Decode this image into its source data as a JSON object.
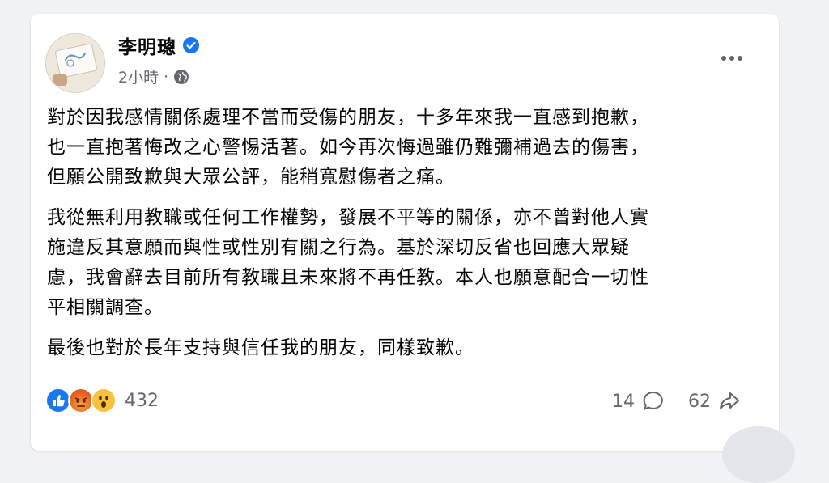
{
  "post": {
    "author": "李明璁",
    "verified": true,
    "time": "2小時",
    "separator": "·",
    "privacy_icon": "globe-icon",
    "more_icon": "more-options-icon",
    "paragraphs": [
      {
        "lines": [
          "對於因我感情關係處理不當而受傷的朋友，十多年來我一直感到抱歉，",
          "也一直抱著悔改之心警惕活著。如今再次悔過雖仍難彌補過去的傷害，",
          "但願公開致歉與大眾公評，能稍寬慰傷者之痛。"
        ]
      },
      {
        "lines": [
          "我從無利用教職或任何工作權勢，發展不平等的關係，亦不曾對他人實",
          "施違反其意願而與性或性別有關之行為。基於深切反省也回應大眾疑",
          "慮，我會辭去目前所有教職且未來將不再任教。本人也願意配合一切性",
          "平相關調查。"
        ]
      },
      {
        "lines": [
          "最後也對於長年支持與信任我的朋友，同樣致歉。"
        ]
      }
    ]
  },
  "reactions": {
    "icons": [
      "like-reaction-icon",
      "angry-reaction-icon",
      "wow-reaction-icon"
    ],
    "count": "432"
  },
  "stats": {
    "comments": "14",
    "shares": "62"
  },
  "colors": {
    "accent": "#1877f2",
    "secondary_text": "#65676b",
    "primary_text": "#050505",
    "background": "#f0f2f5"
  }
}
